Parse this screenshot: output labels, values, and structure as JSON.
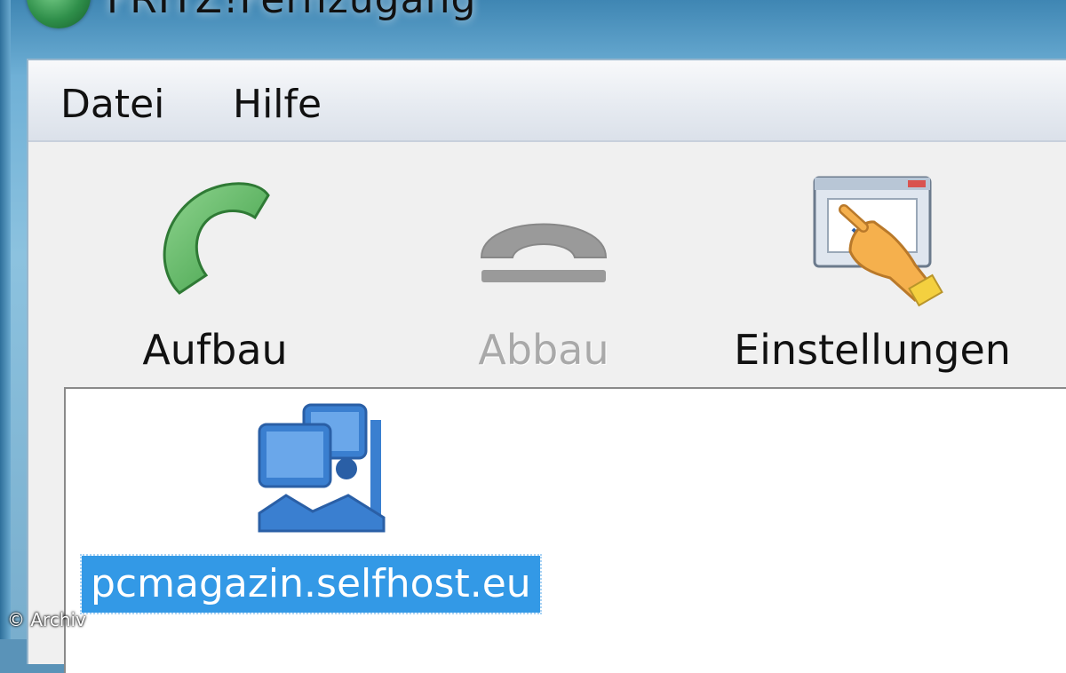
{
  "window": {
    "title": "FRITZ!Fernzugang"
  },
  "menubar": {
    "items": [
      {
        "label": "Datei"
      },
      {
        "label": "Hilfe"
      }
    ]
  },
  "toolbar": {
    "buttons": [
      {
        "label": "Aufbau",
        "icon": "phone-connect-icon",
        "enabled": true,
        "color": "#5cb85c"
      },
      {
        "label": "Abbau",
        "icon": "phone-hangup-icon",
        "enabled": false,
        "color": "#9a9a9a"
      },
      {
        "label": "Einstellungen",
        "icon": "settings-window-hand-icon",
        "enabled": true
      }
    ]
  },
  "connections": {
    "items": [
      {
        "label": "pcmagazin.selfhost.eu",
        "icon": "network-computers-icon",
        "selected": true
      }
    ]
  },
  "watermark": {
    "text": "© Archiv"
  },
  "colors": {
    "selection": "#3399e6",
    "accent": "#6fb0d6"
  }
}
